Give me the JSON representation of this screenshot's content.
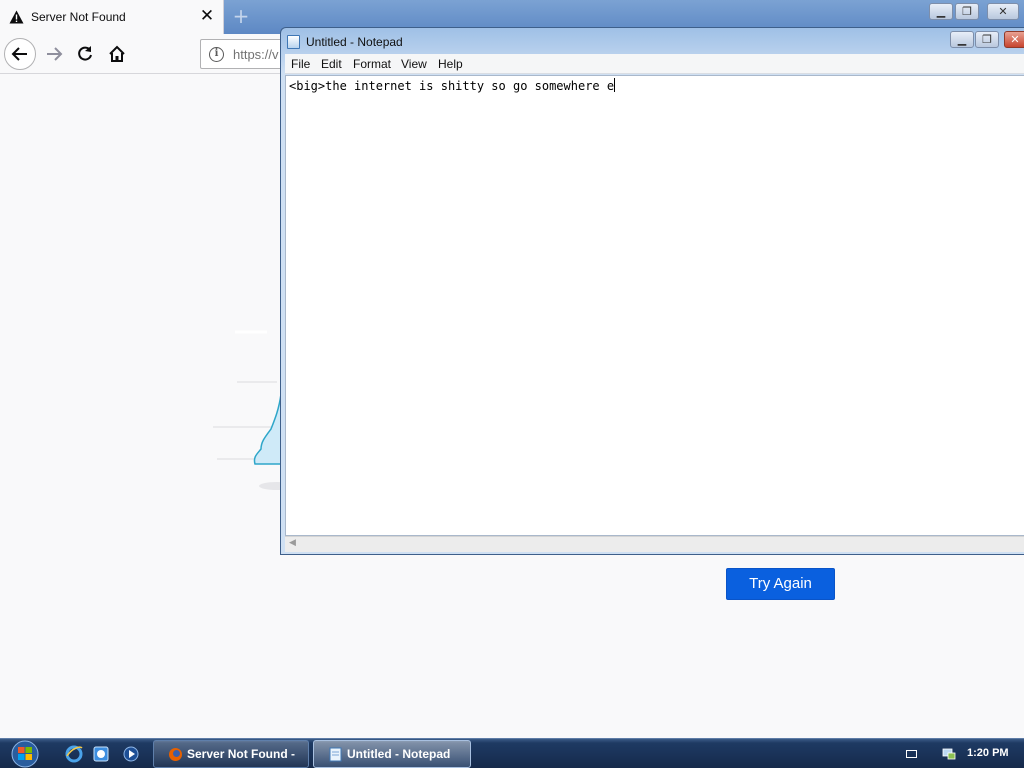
{
  "browser": {
    "tab": {
      "title": "Server Not Found",
      "close_glyph": "✕"
    },
    "new_tab_glyph": "+",
    "window_controls": {
      "minimize": "▁",
      "maximize": "❐",
      "close": "✕"
    },
    "nav": {
      "back_glyph": "←",
      "forward_glyph": "→",
      "reload_glyph": "↻"
    },
    "urlbar": {
      "info_glyph": "i",
      "url": "https://v"
    },
    "page": {
      "try_again_label": "Try Again"
    },
    "accent_color": "#0a60df"
  },
  "notepad": {
    "title": "Untitled - Notepad",
    "window_controls": {
      "minimize": "▁",
      "maximize": "❐",
      "close": "✕"
    },
    "menu": [
      "File",
      "Edit",
      "Format",
      "View",
      "Help"
    ],
    "content": "<big>the internet is shitty so go somewhere e",
    "hscroll_left_glyph": "◀"
  },
  "taskbar": {
    "tasks": [
      {
        "label": "Server Not Found - ...",
        "icon": "firefox-icon"
      },
      {
        "label": "Untitled - Notepad",
        "icon": "notepad-icon"
      }
    ],
    "quick_launch": [
      "internet-explorer-icon",
      "explorer-icon",
      "media-player-icon"
    ],
    "clock": "1:20 PM"
  }
}
